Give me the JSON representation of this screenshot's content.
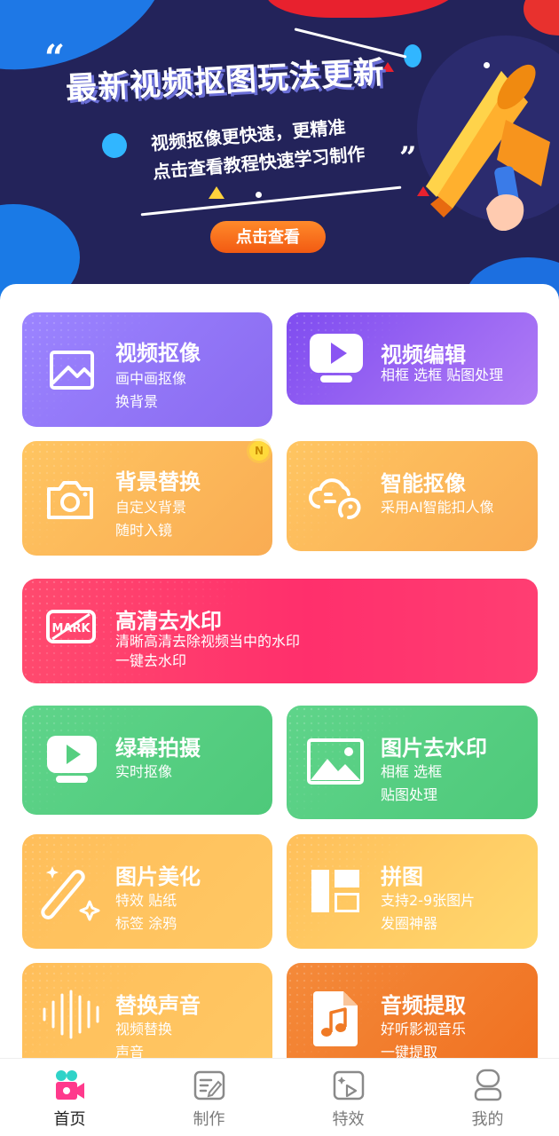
{
  "banner": {
    "title": "最新视频抠图玩法更新",
    "subtitle_line1": "视频抠像更快速，更精准",
    "subtitle_line2": "点击查看教程快速学习制作",
    "button_label": "点击查看"
  },
  "cards": {
    "video_matting": {
      "title": "视频抠像",
      "desc1": "画中画抠像",
      "desc2": "换背景",
      "icon": "image-frame-icon"
    },
    "video_edit": {
      "title": "视频编辑",
      "desc1": "相框 选框 贴图处理",
      "icon": "video-play-icon"
    },
    "bg_replace": {
      "title": "背景替换",
      "desc1": "自定义背景",
      "desc2": "随时入镜",
      "icon": "camera-icon",
      "badge": "N"
    },
    "smart_matting": {
      "title": "智能抠像",
      "desc1": "采用AI智能扣人像",
      "icon": "ai-face-icon"
    },
    "hd_watermark": {
      "title": "高清去水印",
      "desc1": "清晰高清去除视频当中的水印",
      "desc2": "一键去水印",
      "icon": "mark-icon",
      "icon_text": "MARK"
    },
    "green_screen": {
      "title": "绿幕拍摄",
      "desc1": "实时抠像",
      "icon": "monitor-play-icon"
    },
    "image_watermark": {
      "title": "图片去水印",
      "desc1": "相框 选框",
      "desc2": "贴图处理",
      "icon": "picture-icon"
    },
    "image_beauty": {
      "title": "图片美化",
      "desc1": "特效 贴纸",
      "desc2": "标签 涂鸦",
      "icon": "magic-wand-icon"
    },
    "collage": {
      "title": "拼图",
      "desc1": "支持2-9张图片",
      "desc2": "发圈神器",
      "icon": "collage-layout-icon"
    },
    "replace_audio": {
      "title": "替换声音",
      "desc1": "视频替换",
      "desc2": "声音",
      "icon": "sound-wave-icon"
    },
    "audio_extract": {
      "title": "音频提取",
      "desc1": "好听影视音乐",
      "desc2": "一键提取",
      "icon": "music-file-icon"
    }
  },
  "nav": {
    "items": [
      {
        "label": "首页",
        "icon": "home-camera-icon",
        "active": true
      },
      {
        "label": "制作",
        "icon": "edit-board-icon",
        "active": false
      },
      {
        "label": "特效",
        "icon": "effects-icon",
        "active": false
      },
      {
        "label": "我的",
        "icon": "profile-icon",
        "active": false
      }
    ]
  },
  "colors": {
    "banner_bg": "#23235a",
    "accent_orange": "#f25a12",
    "nav_active_pink": "#ff3a8c",
    "nav_inactive": "#7a7a7a"
  }
}
